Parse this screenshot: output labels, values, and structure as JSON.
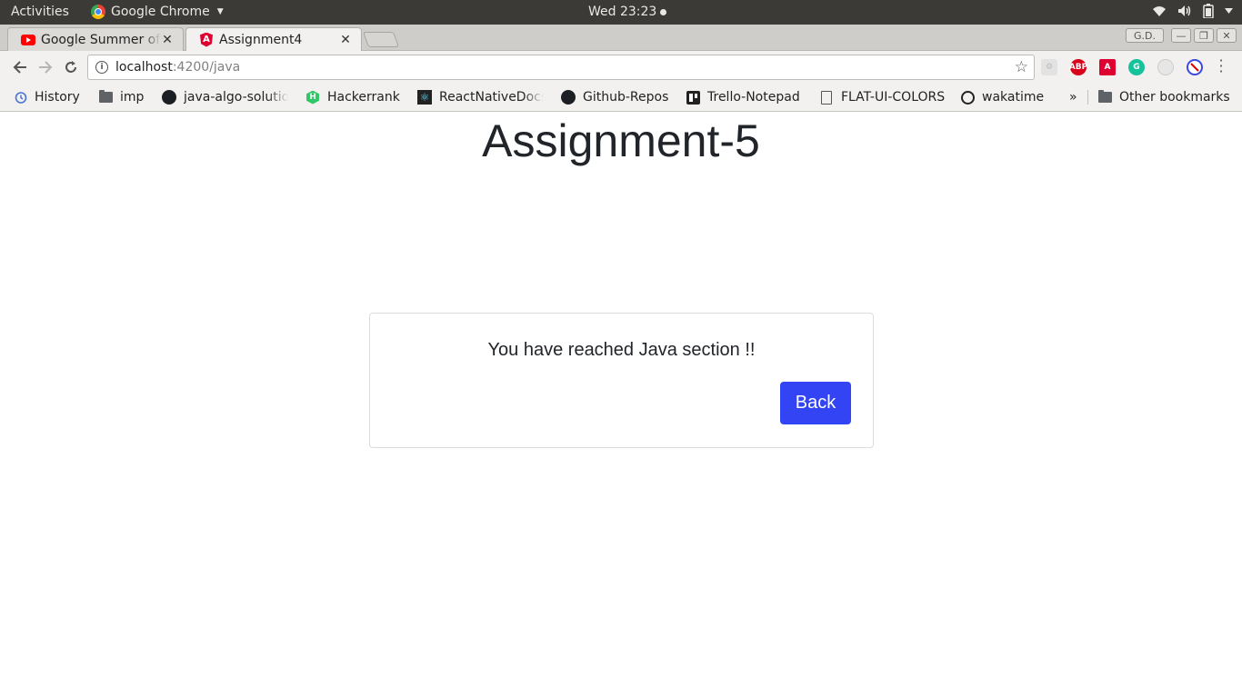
{
  "top_panel": {
    "activities": "Activities",
    "app_name": "Google Chrome",
    "clock": "Wed 23:23"
  },
  "tabs": [
    {
      "title": "Google Summer of Code",
      "active": false
    },
    {
      "title": "Assignment4",
      "active": true
    }
  ],
  "window": {
    "profile_label": "G.D."
  },
  "omnibox": {
    "host": "localhost",
    "path": ":4200/java"
  },
  "extensions": [
    {
      "name": "abp-extension-icon",
      "label": "ABP",
      "color": "#d8001a"
    },
    {
      "name": "angular-extension-icon",
      "label": "A",
      "color": "#dd0031"
    },
    {
      "name": "grammarly-extension-icon",
      "label": "G",
      "color": "#15c39a"
    },
    {
      "name": "block-extension-icon",
      "label": "",
      "color": "#3b49df"
    }
  ],
  "bookmarks": [
    {
      "label": "History",
      "icon": "history-icon"
    },
    {
      "label": "imp",
      "icon": "folder-icon"
    },
    {
      "label": "java-algo-solutions",
      "icon": "github-icon"
    },
    {
      "label": "Hackerrank",
      "icon": "hackerrank-icon"
    },
    {
      "label": "ReactNativeDocs",
      "icon": "react-icon"
    },
    {
      "label": "Github-Repos",
      "icon": "github-icon"
    },
    {
      "label": "Trello-Notepad",
      "icon": "trello-icon"
    },
    {
      "label": "FLAT-UI-COLORS",
      "icon": "page-icon"
    },
    {
      "label": "wakatime",
      "icon": "wakatime-icon"
    }
  ],
  "bookmarks_overflow": "»",
  "other_bookmarks": "Other bookmarks",
  "page": {
    "title": "Assignment-5",
    "message": "You have reached Java section !!",
    "back_label": "Back",
    "accent_color": "#3344f5"
  }
}
